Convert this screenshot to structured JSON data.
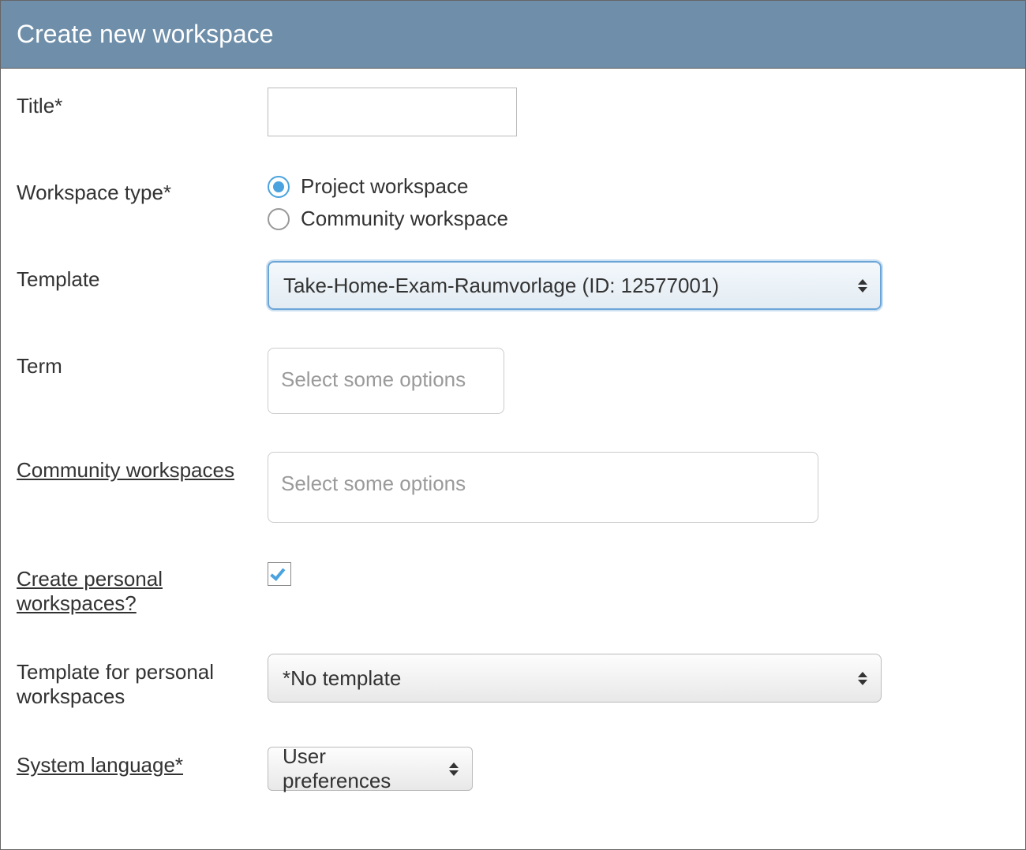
{
  "panel": {
    "title": "Create new workspace"
  },
  "form": {
    "title": {
      "label": "Title*",
      "value": ""
    },
    "workspace_type": {
      "label": "Workspace type*",
      "option_project": "Project workspace",
      "option_community": "Community workspace",
      "selected": "project"
    },
    "template": {
      "label": "Template",
      "selected": "Take-Home-Exam-Raumvorlage (ID: 12577001)"
    },
    "term": {
      "label": "Term",
      "placeholder": "Select some options"
    },
    "community_ws": {
      "label": "Community workspaces",
      "placeholder": "Select some options"
    },
    "personal_ws": {
      "label": "Create personal workspaces?",
      "checked": true
    },
    "personal_template": {
      "label": "Template for personal workspaces",
      "selected": "*No template"
    },
    "system_language": {
      "label": "System language*",
      "selected": "User preferences"
    }
  }
}
